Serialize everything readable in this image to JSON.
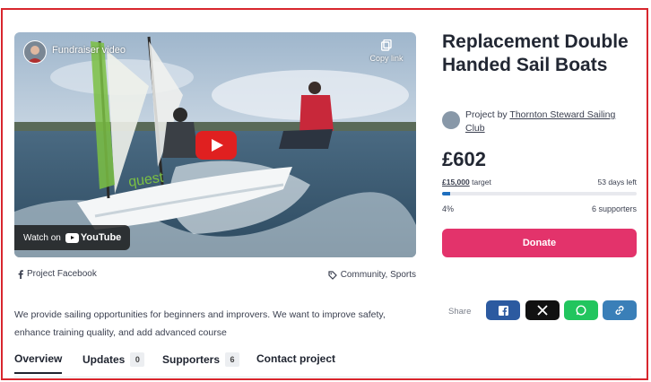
{
  "video": {
    "title": "Fundraiser video",
    "copy_link_label": "Copy link",
    "watch_on_label": "Watch on",
    "youtube_label": "YouTube"
  },
  "project_facebook_label": "Project Facebook",
  "categories": "Community, Sports",
  "description": "We provide sailing opportunities for beginners and improvers. We want to improve safety, enhance training quality, and add advanced course",
  "tabs": [
    {
      "label": "Overview"
    },
    {
      "label": "Updates",
      "count": "0"
    },
    {
      "label": "Supporters",
      "count": "6"
    },
    {
      "label": "Contact project"
    }
  ],
  "project": {
    "title": "Replacement Double Handed Sail Boats",
    "by_prefix": "Project by",
    "organisation": "Thornton Steward Sailing Club",
    "raised": "£602",
    "target_amount": "£15,000",
    "target_suffix": "target",
    "days_left": "53 days left",
    "percent": "4%",
    "progress": 0.04,
    "supporters": "6 supporters",
    "donate_label": "Donate"
  },
  "share": {
    "label": "Share",
    "buttons": [
      "facebook",
      "x",
      "whatsapp",
      "copy-link"
    ]
  },
  "colors": {
    "donate": "#e3336b",
    "progress": "#1e6fbf",
    "facebook": "#2c5aa0",
    "x": "#111111",
    "whatsapp": "#22c55e",
    "link": "#3a7fb8",
    "frame": "#d8262d"
  }
}
